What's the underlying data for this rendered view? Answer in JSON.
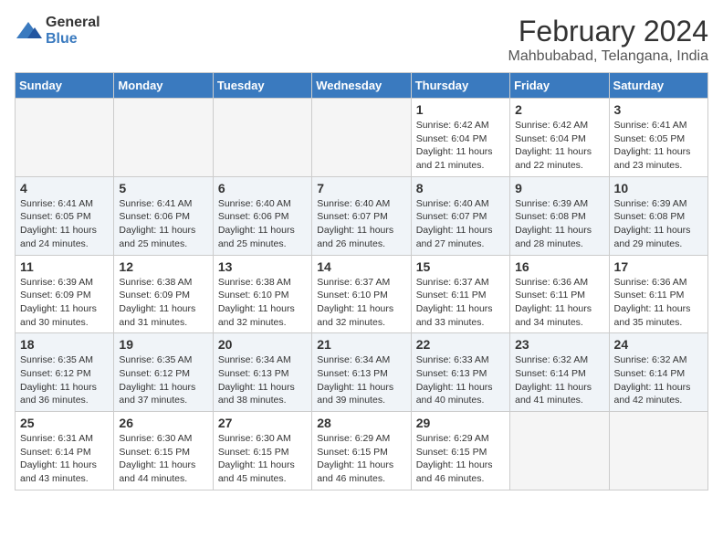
{
  "logo": {
    "general": "General",
    "blue": "Blue"
  },
  "title": "February 2024",
  "location": "Mahbubabad, Telangana, India",
  "weekdays": [
    "Sunday",
    "Monday",
    "Tuesday",
    "Wednesday",
    "Thursday",
    "Friday",
    "Saturday"
  ],
  "weeks": [
    [
      {
        "day": "",
        "info": ""
      },
      {
        "day": "",
        "info": ""
      },
      {
        "day": "",
        "info": ""
      },
      {
        "day": "",
        "info": ""
      },
      {
        "day": "1",
        "info": "Sunrise: 6:42 AM\nSunset: 6:04 PM\nDaylight: 11 hours\nand 21 minutes."
      },
      {
        "day": "2",
        "info": "Sunrise: 6:42 AM\nSunset: 6:04 PM\nDaylight: 11 hours\nand 22 minutes."
      },
      {
        "day": "3",
        "info": "Sunrise: 6:41 AM\nSunset: 6:05 PM\nDaylight: 11 hours\nand 23 minutes."
      }
    ],
    [
      {
        "day": "4",
        "info": "Sunrise: 6:41 AM\nSunset: 6:05 PM\nDaylight: 11 hours\nand 24 minutes."
      },
      {
        "day": "5",
        "info": "Sunrise: 6:41 AM\nSunset: 6:06 PM\nDaylight: 11 hours\nand 25 minutes."
      },
      {
        "day": "6",
        "info": "Sunrise: 6:40 AM\nSunset: 6:06 PM\nDaylight: 11 hours\nand 25 minutes."
      },
      {
        "day": "7",
        "info": "Sunrise: 6:40 AM\nSunset: 6:07 PM\nDaylight: 11 hours\nand 26 minutes."
      },
      {
        "day": "8",
        "info": "Sunrise: 6:40 AM\nSunset: 6:07 PM\nDaylight: 11 hours\nand 27 minutes."
      },
      {
        "day": "9",
        "info": "Sunrise: 6:39 AM\nSunset: 6:08 PM\nDaylight: 11 hours\nand 28 minutes."
      },
      {
        "day": "10",
        "info": "Sunrise: 6:39 AM\nSunset: 6:08 PM\nDaylight: 11 hours\nand 29 minutes."
      }
    ],
    [
      {
        "day": "11",
        "info": "Sunrise: 6:39 AM\nSunset: 6:09 PM\nDaylight: 11 hours\nand 30 minutes."
      },
      {
        "day": "12",
        "info": "Sunrise: 6:38 AM\nSunset: 6:09 PM\nDaylight: 11 hours\nand 31 minutes."
      },
      {
        "day": "13",
        "info": "Sunrise: 6:38 AM\nSunset: 6:10 PM\nDaylight: 11 hours\nand 32 minutes."
      },
      {
        "day": "14",
        "info": "Sunrise: 6:37 AM\nSunset: 6:10 PM\nDaylight: 11 hours\nand 32 minutes."
      },
      {
        "day": "15",
        "info": "Sunrise: 6:37 AM\nSunset: 6:11 PM\nDaylight: 11 hours\nand 33 minutes."
      },
      {
        "day": "16",
        "info": "Sunrise: 6:36 AM\nSunset: 6:11 PM\nDaylight: 11 hours\nand 34 minutes."
      },
      {
        "day": "17",
        "info": "Sunrise: 6:36 AM\nSunset: 6:11 PM\nDaylight: 11 hours\nand 35 minutes."
      }
    ],
    [
      {
        "day": "18",
        "info": "Sunrise: 6:35 AM\nSunset: 6:12 PM\nDaylight: 11 hours\nand 36 minutes."
      },
      {
        "day": "19",
        "info": "Sunrise: 6:35 AM\nSunset: 6:12 PM\nDaylight: 11 hours\nand 37 minutes."
      },
      {
        "day": "20",
        "info": "Sunrise: 6:34 AM\nSunset: 6:13 PM\nDaylight: 11 hours\nand 38 minutes."
      },
      {
        "day": "21",
        "info": "Sunrise: 6:34 AM\nSunset: 6:13 PM\nDaylight: 11 hours\nand 39 minutes."
      },
      {
        "day": "22",
        "info": "Sunrise: 6:33 AM\nSunset: 6:13 PM\nDaylight: 11 hours\nand 40 minutes."
      },
      {
        "day": "23",
        "info": "Sunrise: 6:32 AM\nSunset: 6:14 PM\nDaylight: 11 hours\nand 41 minutes."
      },
      {
        "day": "24",
        "info": "Sunrise: 6:32 AM\nSunset: 6:14 PM\nDaylight: 11 hours\nand 42 minutes."
      }
    ],
    [
      {
        "day": "25",
        "info": "Sunrise: 6:31 AM\nSunset: 6:14 PM\nDaylight: 11 hours\nand 43 minutes."
      },
      {
        "day": "26",
        "info": "Sunrise: 6:30 AM\nSunset: 6:15 PM\nDaylight: 11 hours\nand 44 minutes."
      },
      {
        "day": "27",
        "info": "Sunrise: 6:30 AM\nSunset: 6:15 PM\nDaylight: 11 hours\nand 45 minutes."
      },
      {
        "day": "28",
        "info": "Sunrise: 6:29 AM\nSunset: 6:15 PM\nDaylight: 11 hours\nand 46 minutes."
      },
      {
        "day": "29",
        "info": "Sunrise: 6:29 AM\nSunset: 6:15 PM\nDaylight: 11 hours\nand 46 minutes."
      },
      {
        "day": "",
        "info": ""
      },
      {
        "day": "",
        "info": ""
      }
    ]
  ]
}
